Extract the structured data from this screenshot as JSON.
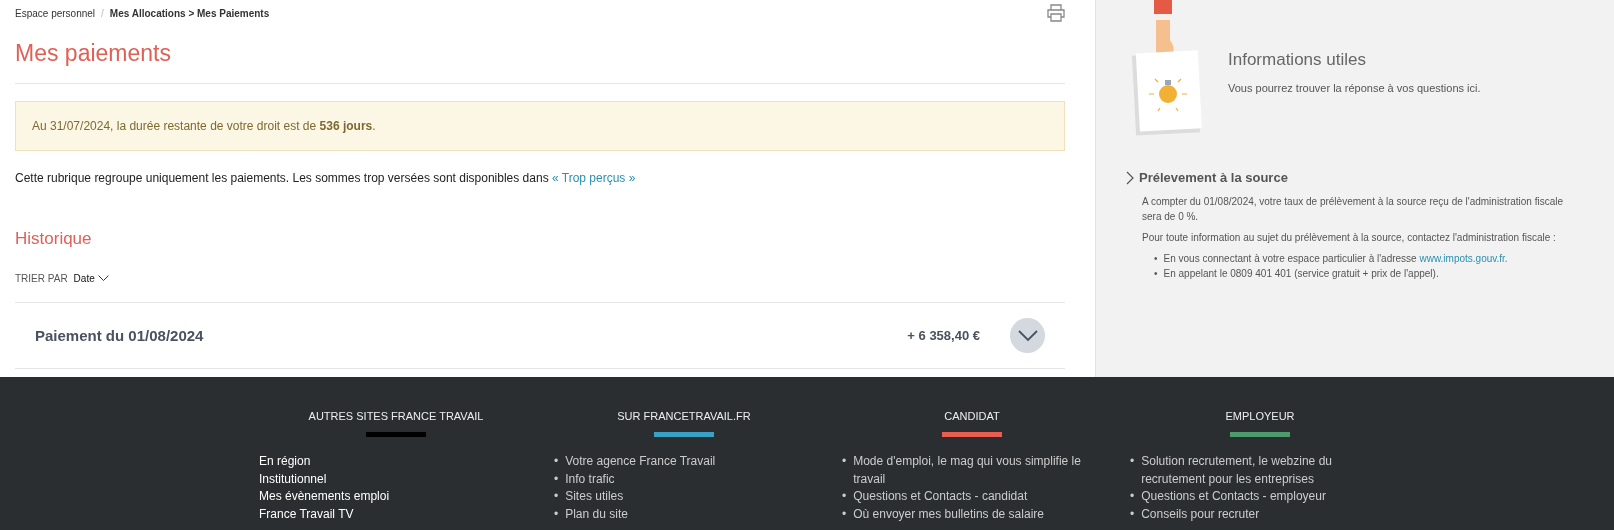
{
  "breadcrumb_separator": "/",
  "breadcrumb": [
    {
      "label": "Espace personnel",
      "kind": "link"
    },
    {
      "label": "Mes Allocations > Mes Paiements",
      "kind": "current"
    }
  ],
  "page_title": "Mes paiements",
  "notice": "Au 31/07/2024, la durée restante de votre droit est de **536 jours**.",
  "intro": {
    "text": "Cette rubrique regroupe uniquement les paiements. Les sommes trop versées sont disponibles dans",
    "link": "« Trop perçus »"
  },
  "history": {
    "title": "Historique",
    "sort_label": "TRIER PAR",
    "sort_value": "Date"
  },
  "payments": [
    {
      "label": "Paiement du 01/08/2024",
      "amount": "+ 6 358,40 €",
      "expanded": false
    }
  ],
  "sidebar": {
    "info_title": "Informations utiles",
    "info_text": "Vous pourrez trouver la réponse à vos questions ici.",
    "section": {
      "title": "Prélevement à la source",
      "expanded": true,
      "paragraphs": [
        "A compter du 01/08/2024, votre taux de prélèvement à la source reçu de l'administration fiscale sera de 0 %.",
        "Pour toute information au sujet du prélèvement à la source, contactez l'administration fiscale :"
      ],
      "bullet_marker": "•",
      "bullets": [
        {
          "text": "En vous connectant à votre espace particulier à l'adresse",
          "link": "www.impots.gouv.fr."
        },
        {
          "text": "En appelant le 0809 401 401 (service gratuit + prix de l'appel)."
        }
      ]
    }
  },
  "footer": [
    {
      "title": "AUTRES SITES FRANCE TRAVAIL",
      "color": "#000000",
      "kind": "plain",
      "items": [
        "En région",
        "Institutionnel",
        "Mes évènements emploi",
        "France Travail TV"
      ]
    },
    {
      "title": "SUR FRANCETRAVAIL.FR",
      "color": "#3aa0c4",
      "kind": "bulleted",
      "marker": "•",
      "items": [
        "Votre agence France Travail",
        "Info trafic",
        "Sites utiles",
        "Plan du site"
      ]
    },
    {
      "title": "CANDIDAT",
      "color": "#e85d50",
      "kind": "bulleted",
      "marker": "•",
      "items": [
        "Mode d'emploi, le mag qui vous simplifie le travail",
        "Questions et Contacts - candidat",
        "Où envoyer mes bulletins de salaire"
      ]
    },
    {
      "title": "EMPLOYEUR",
      "color": "#4e9a6e",
      "kind": "bulleted",
      "marker": "•",
      "items": [
        "Solution recrutement, le webzine du recrutement pour les entreprises",
        "Questions et Contacts - employeur",
        "Conseils pour recruter"
      ]
    }
  ]
}
